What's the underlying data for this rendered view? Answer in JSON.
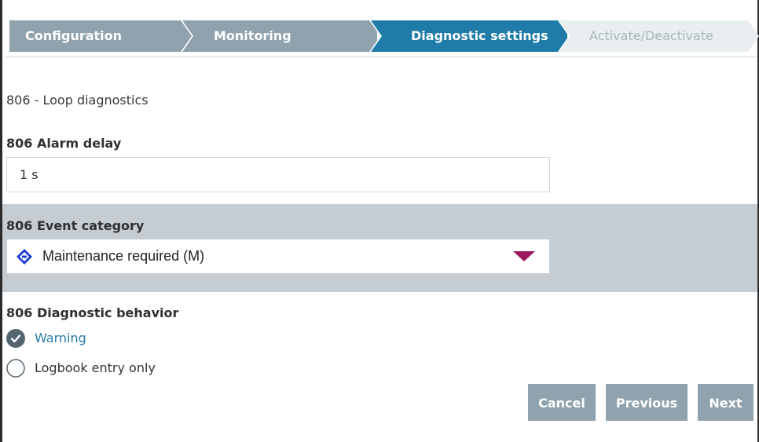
{
  "wizard": {
    "steps": [
      {
        "label": "Configuration",
        "state": "completed"
      },
      {
        "label": "Monitoring",
        "state": "completed"
      },
      {
        "label": "Diagnostic settings",
        "state": "active"
      },
      {
        "label": "Activate/Deactivate",
        "state": "pending"
      }
    ],
    "colors": {
      "completed": "#8fa2ad",
      "active": "#1f7ca8",
      "pending": "#e9eef1"
    }
  },
  "page": {
    "section_title": "806 - Loop diagnostics"
  },
  "alarm_delay": {
    "label": "806 Alarm delay",
    "value": "1 s"
  },
  "event_category": {
    "label": "806 Event category",
    "selected": "Maintenance required (M)",
    "icon": "maintenance-diamond-icon",
    "icon_color": "#1e3fd0",
    "arrow_color": "#9b1a5c"
  },
  "diagnostic_behavior": {
    "label": "806 Diagnostic behavior",
    "options": [
      {
        "label": "Warning",
        "checked": true
      },
      {
        "label": "Logbook entry only",
        "checked": false
      }
    ]
  },
  "buttons": {
    "cancel": "Cancel",
    "previous": "Previous",
    "next": "Next"
  }
}
